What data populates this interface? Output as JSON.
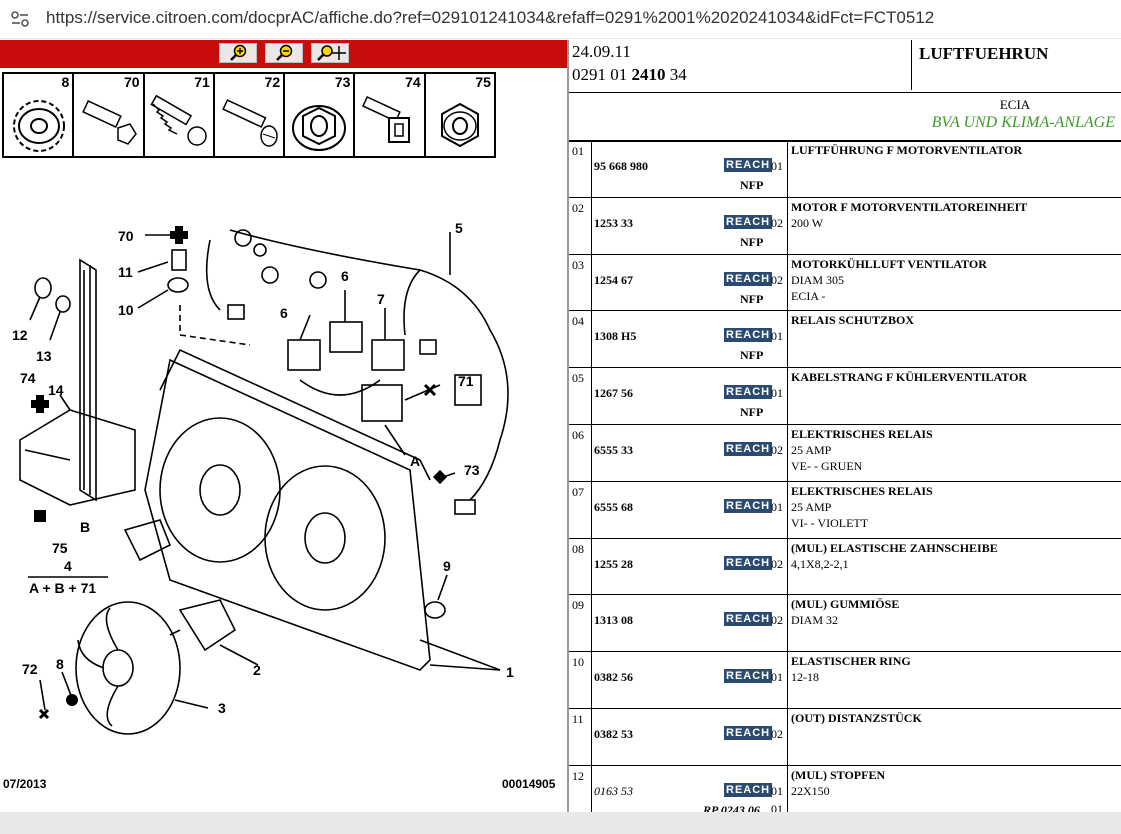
{
  "browser": {
    "url": "https://service.citroen.com/docprAC/affiche.do?ref=029101241034&refaff=0291%2001%2020241034&idFct=FCT0512"
  },
  "parts_strip": [
    "8",
    "70",
    "71",
    "72",
    "73",
    "74",
    "75"
  ],
  "diagram": {
    "date": "07/2013",
    "code": "00014905",
    "labels": [
      "70",
      "11",
      "10",
      "12",
      "13",
      "74",
      "14",
      "75",
      "4",
      "A + B + 71",
      "B",
      "5",
      "6",
      "6",
      "7",
      "71",
      "A",
      "73",
      "9",
      "2",
      "72",
      "8",
      "3",
      "1"
    ]
  },
  "header": {
    "date": "24.09.11",
    "ref_a": "0291 01 ",
    "ref_b": "2410",
    "ref_c": " 34",
    "title": "LUFTFUEHRUN"
  },
  "subheader": {
    "ecia": "ECIA",
    "note": "BVA UND KLIMA-ANLAGE"
  },
  "rows": [
    {
      "n": "01",
      "pn": "95 668 980",
      "qty": "01",
      "nfp": "NFP",
      "desc": "LUFTFÜHRUNG F MOTORVENTILATOR",
      "d2": "",
      "d3": ""
    },
    {
      "n": "02",
      "pn": "1253 33",
      "qty": "02",
      "nfp": "NFP",
      "desc": "MOTOR F MOTORVENTILATOREINHEIT",
      "d2": "200 W",
      "d3": ""
    },
    {
      "n": "03",
      "pn": "1254 67",
      "qty": "02",
      "nfp": "NFP",
      "desc": "MOTORKÜHLLUFT VENTILATOR",
      "d2": "DIAM 305",
      "d3": "ECIA -"
    },
    {
      "n": "04",
      "pn": "1308 H5",
      "qty": "01",
      "nfp": "NFP",
      "desc": "RELAIS SCHUTZBOX",
      "d2": "",
      "d3": ""
    },
    {
      "n": "05",
      "pn": "1267 56",
      "qty": "01",
      "nfp": "NFP",
      "desc": "KABELSTRANG F KÜHLERVENTILATOR",
      "d2": "",
      "d3": ""
    },
    {
      "n": "06",
      "pn": "6555 33",
      "qty": "02",
      "nfp": "",
      "desc": "ELEKTRISCHES RELAIS",
      "d2": "25 AMP",
      "d3": "VE- - GRUEN"
    },
    {
      "n": "07",
      "pn": "6555 68",
      "qty": "01",
      "nfp": "",
      "desc": "ELEKTRISCHES RELAIS",
      "d2": "25 AMP",
      "d3": "VI- - VIOLETT"
    },
    {
      "n": "08",
      "pn": "1255 28",
      "qty": "02",
      "nfp": "",
      "desc": "(MUL) ELASTISCHE ZAHNSCHEIBE",
      "d2": "4,1X8,2-2,1",
      "d3": ""
    },
    {
      "n": "09",
      "pn": "1313 08",
      "qty": "02",
      "nfp": "",
      "desc": "(MUL) GUMMIÖSE",
      "d2": "DIAM 32",
      "d3": ""
    },
    {
      "n": "10",
      "pn": "0382 56",
      "qty": "01",
      "nfp": "",
      "desc": "ELASTISCHER RING",
      "d2": "12-18",
      "d3": ""
    },
    {
      "n": "11",
      "pn": "0382 53",
      "qty": "02",
      "nfp": "",
      "desc": "(OUT) DISTANZSTÜCK",
      "d2": "",
      "d3": ""
    },
    {
      "n": "12",
      "pn": "0163 53",
      "qty": "01",
      "nfp": "",
      "desc": "(MUL) STOPFEN",
      "d2": "22X150",
      "d3": "",
      "rp": "RP 0243 06",
      "rpq": "01",
      "italic": true
    }
  ],
  "reach_label": "REACH",
  "colors": {
    "zoombar": "#c80c0c",
    "reach": "#2b4a70",
    "note": "#3a9a28"
  }
}
